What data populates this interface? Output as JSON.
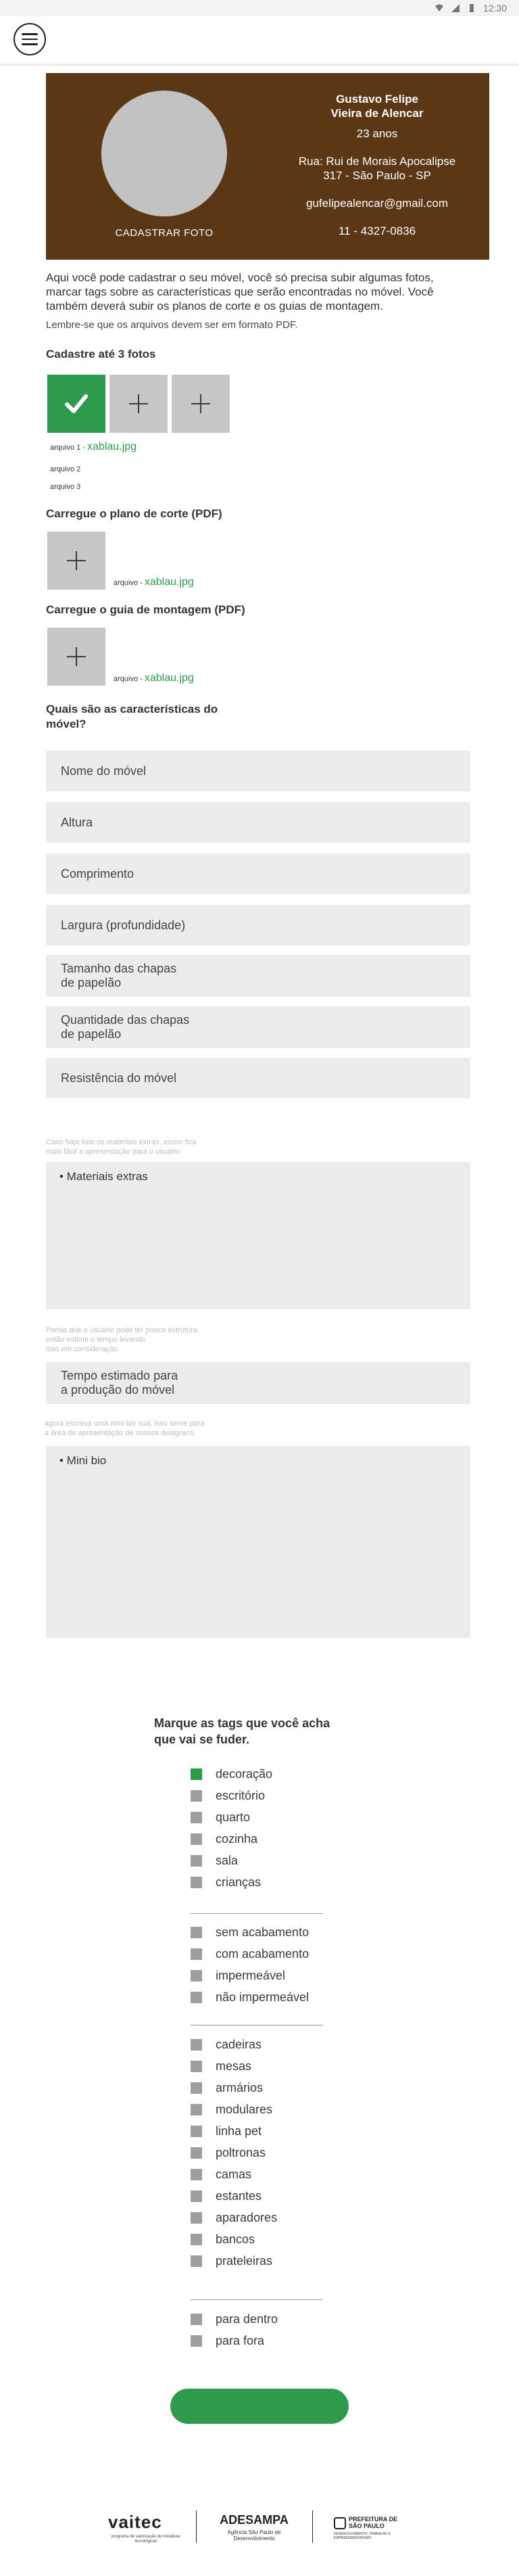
{
  "status_bar": {
    "time": "12:30",
    "icons": [
      "wifi-icon",
      "signal-icon",
      "battery-icon"
    ]
  },
  "header": {
    "menu_icon": "hamburger-menu-icon"
  },
  "profile": {
    "photo_label": "CADASTRAR FOTO",
    "name_line1": "Gustavo Felipe",
    "name_line2": "Vieira de Alencar",
    "age": "23 anos",
    "address_line1": "Rua: Rui de Morais Apocalipse",
    "address_line2": "317 - São Paulo - SP",
    "email": "gufelipealencar@gmail.com",
    "phone": "11 - 4327-0836"
  },
  "intro": {
    "line1": "Aqui você pode cadastrar o seu móvel, você só precisa subir algumas fotos,",
    "line2": "marcar tags sobre as características que serão encontradas no móvel. Você",
    "line3": "também deverá subir os planos de corte e os guias de montagem.",
    "note": "Lembre-se que os arquivos devem ser em formato PDF."
  },
  "photos": {
    "title": "Cadastre até 3 fotos",
    "files": [
      {
        "label": "arquivo 1 -",
        "name": "xablau.jpg"
      },
      {
        "label": "arquivo 2",
        "name": ""
      },
      {
        "label": "arquivo 3",
        "name": ""
      }
    ]
  },
  "cut_plan": {
    "title": "Carregue o plano de corte (PDF)",
    "file_label": "arquivo -",
    "file_name": "xablau.jpg"
  },
  "assembly_guide": {
    "title": "Carregue o guia de montagem (PDF)",
    "file_label": "arquivo -",
    "file_name": "xablau.jpg"
  },
  "characteristics": {
    "title_line1": "Quais são as características do",
    "title_line2": "móvel?",
    "fields": [
      {
        "line1": "Nome do móvel",
        "line2": ""
      },
      {
        "line1": "Altura",
        "line2": ""
      },
      {
        "line1": "Comprimento",
        "line2": ""
      },
      {
        "line1": "Largura (profundidade)",
        "line2": ""
      },
      {
        "line1": "Tamanho das chapas",
        "line2": "de papelão"
      },
      {
        "line1": "Quantidade das chapas",
        "line2": "de papelão"
      },
      {
        "line1": "Resistência do móvel",
        "line2": ""
      }
    ]
  },
  "extras": {
    "hint_line1": "Caso haja liste os materiais extras, assim fica",
    "hint_line2": "mais fácil a apresentação para o usuário",
    "placeholder": "• Materiais extras"
  },
  "time": {
    "hint_line1": "Pense que o usuário pode ter pouca estrutura",
    "hint_line2": "então estime o tempo levando",
    "hint_line3": "isso em consideração",
    "line1": "Tempo estimado para",
    "line2": "a produção do móvel"
  },
  "bio": {
    "hint_line1": "agora escreva uma mini bio sua, isso serve para",
    "hint_line2": "a área de apresentação de nossos designers.",
    "placeholder": "• Mini bio"
  },
  "tags": {
    "title_line1": "Marque as tags que você acha",
    "title_line2": "que vai se fuder.",
    "groups": [
      [
        {
          "label": "decoração",
          "checked": true
        },
        {
          "label": "escritório",
          "checked": false
        },
        {
          "label": "quarto",
          "checked": false
        },
        {
          "label": "cozinha",
          "checked": false
        },
        {
          "label": "sala",
          "checked": false
        },
        {
          "label": "crianças",
          "checked": false
        }
      ],
      [
        {
          "label": "sem acabamento",
          "checked": false
        },
        {
          "label": "com acabamento",
          "checked": false
        },
        {
          "label": "impermeável",
          "checked": false
        },
        {
          "label": "não impermeável",
          "checked": false
        }
      ],
      [
        {
          "label": "cadeiras",
          "checked": false
        },
        {
          "label": "mesas",
          "checked": false
        },
        {
          "label": "armários",
          "checked": false
        },
        {
          "label": "modulares",
          "checked": false
        },
        {
          "label": "linha pet",
          "checked": false
        },
        {
          "label": "poltronas",
          "checked": false
        },
        {
          "label": "camas",
          "checked": false
        },
        {
          "label": "estantes",
          "checked": false
        },
        {
          "label": "aparadores",
          "checked": false
        },
        {
          "label": "bancos",
          "checked": false
        },
        {
          "label": "prateleiras",
          "checked": false
        }
      ],
      [
        {
          "label": "para dentro",
          "checked": false
        },
        {
          "label": "para fora",
          "checked": false
        }
      ]
    ]
  },
  "colors": {
    "brown": "#5b3716",
    "green": "#2e9b4c",
    "field_bg": "#ececec",
    "tile_gray": "#c7c7c7"
  },
  "footer": {
    "vaitec": "vaitec",
    "vaitec_sub": "programa de valorização de iniciativas tecnológicas",
    "adesampa": "ADESAMPA",
    "adesampa_sub_line1": "Agência São Paulo de",
    "adesampa_sub_line2": "Desenvolvimento",
    "prefeitura_line1": "PREFEITURA DE",
    "prefeitura_line2": "SÃO PAULO",
    "prefeitura_sub": "DESENVOLVIMENTO, TRABALHO E EMPREENDEDORISMO"
  }
}
